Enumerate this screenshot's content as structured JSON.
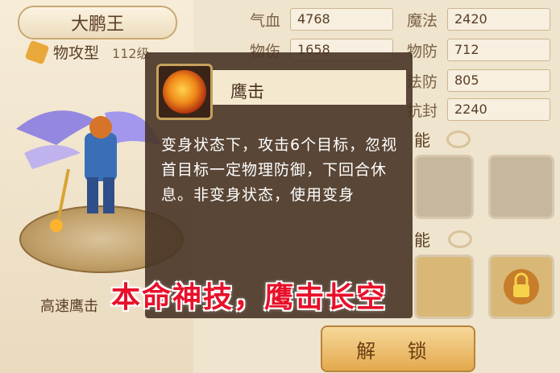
{
  "character": {
    "name": "大鹏王",
    "type_label": "物攻型",
    "level_text": "112级",
    "caption": "高速鹰击"
  },
  "stats": [
    {
      "label": "气血",
      "value": "4768"
    },
    {
      "label": "魔法",
      "value": "2420"
    },
    {
      "label": "物伤",
      "value": "1658"
    },
    {
      "label": "物防",
      "value": "712"
    },
    {
      "label": "法防",
      "value": "805"
    },
    {
      "label": "抗封",
      "value": "2240"
    }
  ],
  "section_labels": {
    "skills_top": "能",
    "skills_bottom": "能"
  },
  "tooltip": {
    "skill_name": "鹰击",
    "icon": "eagle-strike-icon",
    "description": "变身状态下，攻击6个目标，忽视首目标一定物理防御，下回合休息。非变身状态，使用变身"
  },
  "unlock_button": "解 锁",
  "overlay_caption": "本命神技，鹰击长空",
  "colors": {
    "caption_red": "#e8102a",
    "tooltip_bg": "#483426",
    "button_gold": "#e3a94d"
  }
}
